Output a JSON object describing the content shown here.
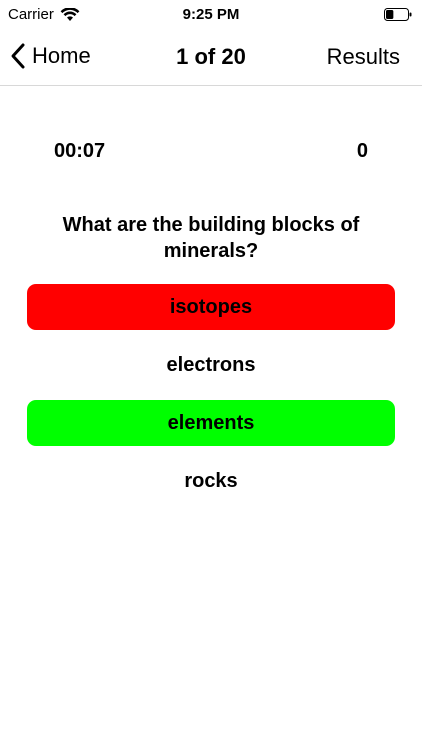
{
  "status_bar": {
    "carrier": "Carrier",
    "time": "9:25 PM",
    "wifi_icon": "wifi-icon",
    "battery_icon": "battery-icon",
    "battery_level": 0.35
  },
  "nav": {
    "back_label": "Home",
    "back_icon": "chevron-left-icon",
    "title": "1 of 20",
    "results_label": "Results"
  },
  "quiz": {
    "timer": "00:07",
    "score": "0",
    "question": "What are the building blocks of minerals?",
    "answers": [
      {
        "label": "isotopes",
        "state": "wrong",
        "color": "#ff0000"
      },
      {
        "label": "electrons",
        "state": "neutral",
        "color": "#ffffff"
      },
      {
        "label": "elements",
        "state": "correct",
        "color": "#00ff00"
      },
      {
        "label": "rocks",
        "state": "neutral",
        "color": "#ffffff"
      }
    ]
  }
}
